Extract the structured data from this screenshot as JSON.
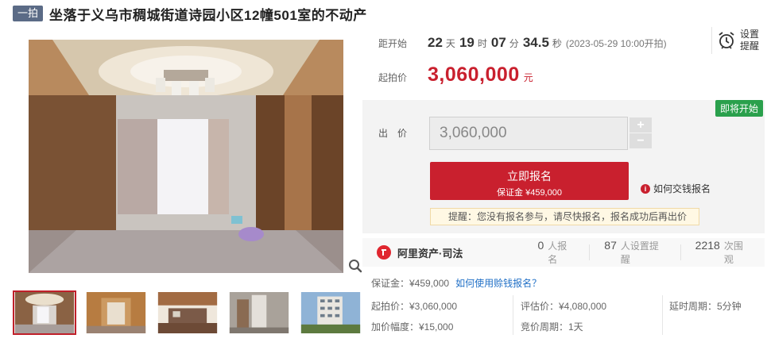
{
  "header": {
    "tag": "一拍",
    "title": "坐落于义乌市稠城街道诗园小区12幢501室的不动产"
  },
  "countdown": {
    "label": "距开始",
    "days": "22",
    "days_unit": "天",
    "hours": "19",
    "hours_unit": "时",
    "minutes": "07",
    "minutes_unit": "分",
    "seconds": "34.5",
    "seconds_unit": "秒",
    "start_note": "(2023-05-29 10:00开拍)"
  },
  "reminder": {
    "label": "设置提醒",
    "icon": "alarm-clock-icon"
  },
  "start_price": {
    "label": "起拍价",
    "value": "3,060,000",
    "unit": "元"
  },
  "bid": {
    "badge": "即将开始",
    "label": "出价",
    "input_value": "3,060,000",
    "plus": "+",
    "minus": "−",
    "signup_main": "立即报名",
    "signup_sub": "保证金 ¥459,000",
    "help_text": "如何交钱报名",
    "tip": "提醒：您没有报名参与，请尽快报名，报名成功后再出价"
  },
  "stats": {
    "brand": "阿里资产·司法",
    "signups_num": "0",
    "signups_text": "人报名",
    "reminders_num": "87",
    "reminders_text": "人设置提醒",
    "views_num": "2218",
    "views_text": "次围观"
  },
  "details": {
    "deposit_label": "保证金：¥459,000",
    "deposit_link": "如何使用赊钱报名？",
    "start_price": "起拍价：¥3,060,000",
    "increment": "加价幅度：¥15,000",
    "appraisal": "评估价：¥4,080,000",
    "bid_period": "竞价周期：1天",
    "delay_period": "延时周期：5分钟"
  },
  "colors": {
    "accent": "#c9202e",
    "badge_green": "#2aa04c",
    "tag_bg": "#5b6b86",
    "link": "#1f6fc6"
  }
}
